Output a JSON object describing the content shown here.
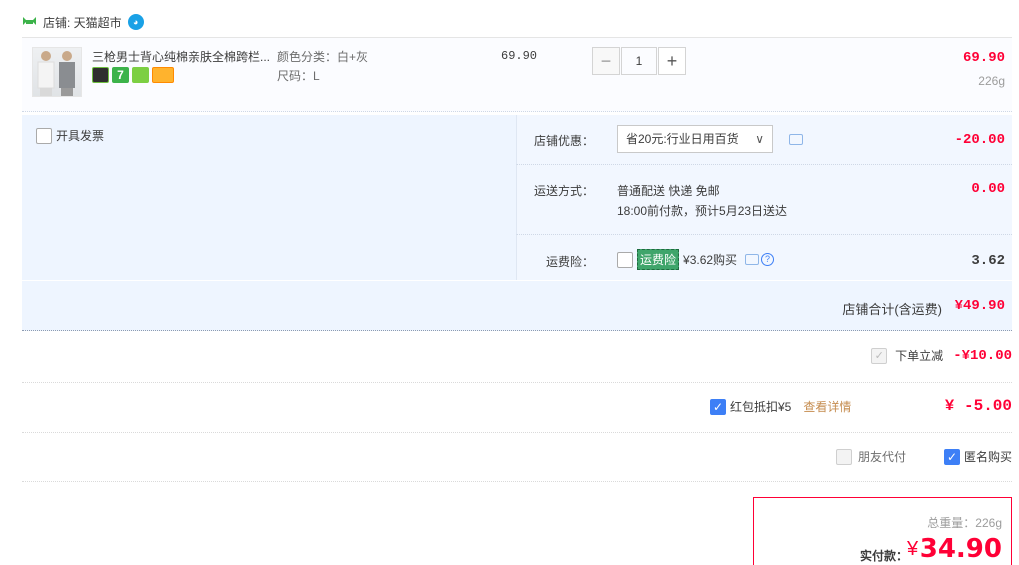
{
  "shop": {
    "label": "店铺: 天猫超市",
    "icon": "tmall-icon",
    "chat_icon": "wangwang-chat-icon"
  },
  "item": {
    "title": "三枪男士背心纯棉亲肤全棉跨栏...",
    "badges": [
      "tmall-badge-icon",
      "seven-day-return-icon",
      "guarantee-icon",
      "credit-card-icon"
    ],
    "sku": {
      "color": "颜色分类：白+灰",
      "size": "尺码：L"
    },
    "unit_price": "69.90",
    "quantity": "1",
    "minus_label": "−",
    "plus_label": "+",
    "total_price": "69.90",
    "weight": "226g"
  },
  "invoice": {
    "label": "开具发票"
  },
  "coupon": {
    "label": "店铺优惠：",
    "selected": "省20元:行业日用百货",
    "amount": "-20.00"
  },
  "shipping": {
    "label": "运送方式：",
    "line1": "普通配送 快递 免邮",
    "line2": "18:00前付款，预计5月23日送达",
    "amount": "0.00"
  },
  "insurance": {
    "label": "运费险：",
    "tag": "运费险",
    "text": "¥3.62购买",
    "help": "?",
    "amount": "3.62"
  },
  "shop_total": {
    "label": "店铺合计(含运费)",
    "amount": "¥49.90"
  },
  "instant_discount": {
    "label": "下单立减",
    "amount": "-¥10.00"
  },
  "red_packet": {
    "label": "红包抵扣¥5",
    "link": "查看详情",
    "amount": "¥ -5.00"
  },
  "friend_pay": {
    "label": "朋友代付"
  },
  "anonymous": {
    "label": "匿名购买"
  },
  "payment": {
    "weight_label": "总重量：226g",
    "pay_label": "实付款：",
    "currency": "¥",
    "amount": "34.90"
  },
  "colors": {
    "accent_red": "#ff0036",
    "checkbox_blue": "#3d7ff6",
    "panel_bg": "#eef5ff"
  }
}
